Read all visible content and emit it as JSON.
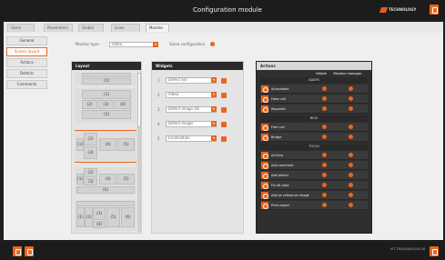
{
  "app": {
    "title": "Configuration module",
    "brand": "TECHNOLOGY",
    "accent": "#e8671f"
  },
  "tabs": [
    {
      "label": "Users"
    },
    {
      "label": "Parameters"
    },
    {
      "label": "Global"
    },
    {
      "label": "Lines"
    },
    {
      "label": "Monitor"
    }
  ],
  "sidebar": {
    "items": [
      {
        "label": "General"
      },
      {
        "label": "Screen layout"
      },
      {
        "label": "Actions"
      },
      {
        "label": "Defects"
      },
      {
        "label": "Comments"
      }
    ]
  },
  "screen": {
    "monitor_type_label": "Monitor type :",
    "monitor_type_value": "Video",
    "same_configuration_label": "Same configuration"
  },
  "layout_panel": {
    "title": "Layout",
    "layouts": [
      {
        "cells": [
          "(1)"
        ]
      },
      {
        "cells": [
          "(1)",
          "(2)",
          "(3)",
          "(4)",
          "(5)"
        ]
      },
      {
        "cells": [
          "(2)",
          "(1)",
          "(3)",
          "(4)",
          "(5)"
        ]
      },
      {
        "cells": [
          "(2)",
          "(1)",
          "(3)",
          "(4)",
          "(5)",
          "(6)"
        ]
      },
      {
        "cells": [
          "(3)",
          "(1)",
          "(2)",
          "(4)",
          "(5)",
          "(6)"
        ]
      }
    ]
  },
  "widgets_panel": {
    "title": "Widgets",
    "rows": [
      {
        "num": "1",
        "value": "Defect list"
      },
      {
        "num": "2",
        "value": "Video"
      },
      {
        "num": "3",
        "value": "Defect image 3D"
      },
      {
        "num": "4",
        "value": "Defect image"
      },
      {
        "num": "5",
        "value": "Localisation"
      }
    ]
  },
  "actions_panel": {
    "title": "Actions",
    "col_visible": "Visible",
    "col_manager": "Monitor manager",
    "groups": [
      {
        "name": "ADAPS",
        "rows": [
          "Acceptable",
          "False call",
          "Repaired"
        ]
      },
      {
        "name": "BIOS",
        "rows": [
          "Free call",
          "Bridge"
        ]
      },
      {
        "name": "TOOLS",
        "rows": [
          "Archive",
          "Add comment",
          "Add defect",
          "Fix all code",
          "Add as reference image",
          "Print report"
        ]
      }
    ]
  },
  "status": {
    "right_text": "VIT 2025/04/01/10:16"
  }
}
